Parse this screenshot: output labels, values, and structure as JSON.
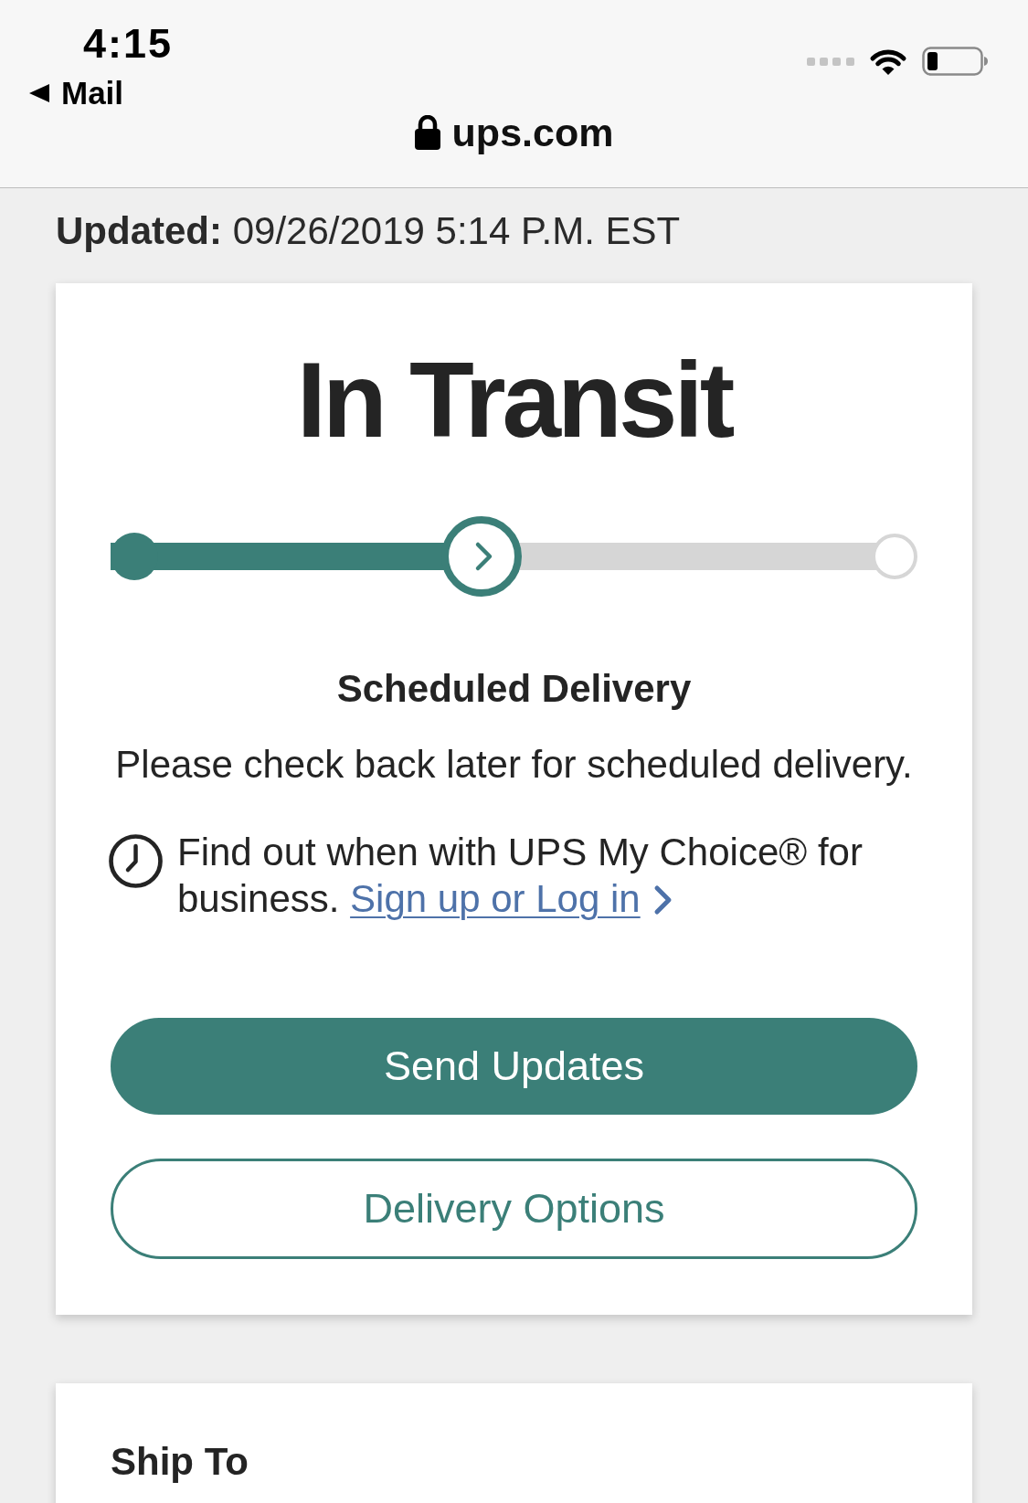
{
  "status_bar": {
    "time": "4:15",
    "back_link": "Mail"
  },
  "address_bar": {
    "url": "ups.com",
    "secure": true
  },
  "updated": "**Updated:** 09/26/2019 5:14 P.M. EST",
  "status_card": {
    "status": "In Transit",
    "progress": {
      "level": 0.46
    },
    "section_title": "Scheduled Delivery",
    "message": "Please check back later for scheduled delivery.",
    "my_choice": {
      "text": "Find out when with UPS My Choice® for business.",
      "link": "Sign up or Log in"
    },
    "buttons": [
      {
        "label": "Send Updates",
        "kind": "primary"
      },
      {
        "label": "Delivery Options",
        "kind": "secondary"
      }
    ]
  },
  "ship_to": {
    "title": "Ship To"
  }
}
